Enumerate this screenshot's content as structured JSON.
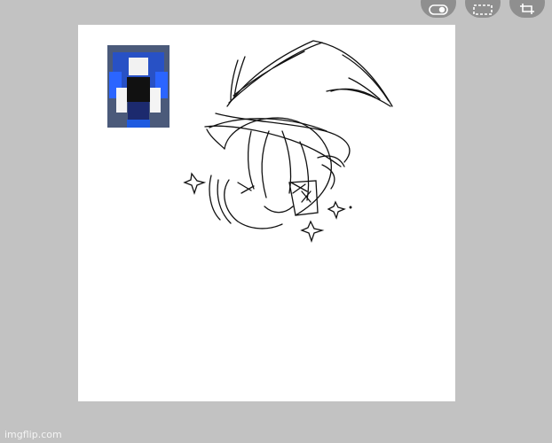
{
  "toolbar": {
    "buttons": [
      {
        "icon": "toggle-icon"
      },
      {
        "icon": "marquee-select-icon"
      },
      {
        "icon": "crop-icon"
      }
    ]
  },
  "canvas": {
    "background": "#ffffff",
    "reference_image": {
      "subject": "blocky-avatar-character"
    },
    "drawing": {
      "subject": "wizard-hat-character-sketch",
      "stroke_color": "#111111"
    }
  },
  "watermark": {
    "text": "imgflip.com"
  }
}
